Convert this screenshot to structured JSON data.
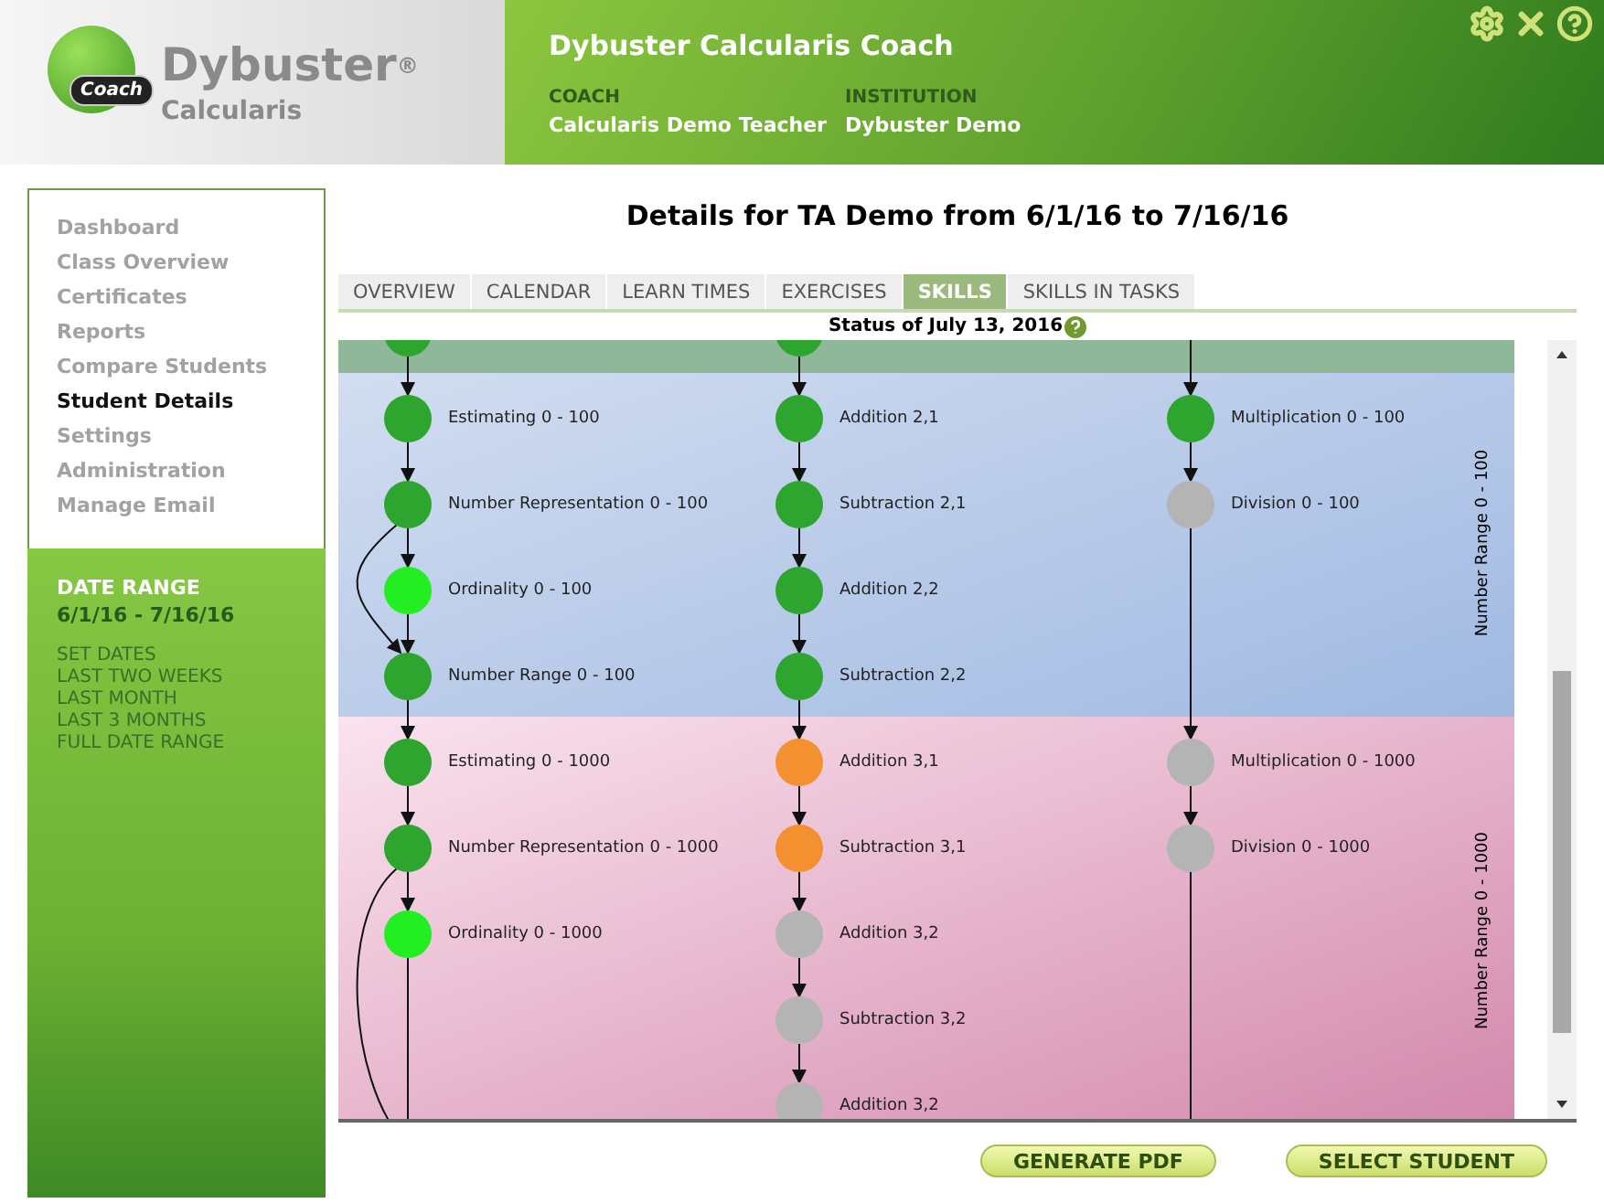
{
  "logo": {
    "badge": "Coach",
    "name": "Dybuster$^{®}$",
    "product": "Calcularis"
  },
  "header": {
    "title": "Dybuster Calcularis Coach",
    "fields": [
      {
        "label": "COACH",
        "value": "Calcularis Demo Teacher"
      },
      {
        "label": "INSTITUTION",
        "value": "Dybuster Demo"
      }
    ]
  },
  "sidebar": {
    "items": [
      {
        "label": "Dashboard",
        "selected": false
      },
      {
        "label": "Class Overview",
        "selected": false
      },
      {
        "label": "Certificates",
        "selected": false
      },
      {
        "label": "Reports",
        "selected": false
      },
      {
        "label": "Compare Students",
        "selected": false
      },
      {
        "label": "Student Details",
        "selected": true
      },
      {
        "label": "Settings",
        "selected": false
      },
      {
        "label": "Administration",
        "selected": false
      },
      {
        "label": "Manage Email",
        "selected": false
      }
    ],
    "date_range": {
      "title": "DATE RANGE",
      "value": "6/1/16 - 7/16/16",
      "links": [
        "SET DATES",
        "LAST TWO WEEKS",
        "LAST MONTH",
        "LAST 3 MONTHS",
        "FULL DATE RANGE"
      ]
    }
  },
  "title": "Details for TA Demo from 6/1/16 to 7/16/16",
  "tabs": [
    {
      "label": "OVERVIEW",
      "selected": false
    },
    {
      "label": "CALENDAR",
      "selected": false
    },
    {
      "label": "LEARN TIMES",
      "selected": false
    },
    {
      "label": "EXERCISES",
      "selected": false
    },
    {
      "label": "SKILLS",
      "selected": true
    },
    {
      "label": "SKILLS IN TASKS",
      "selected": false
    }
  ],
  "status": "Status of July 13, 2016",
  "skill_map": {
    "bands": [
      {
        "kind": "green",
        "columns": [
          [
            {
              "color": "#2ea52e"
            }
          ],
          [
            {
              "color": "#2ea52e"
            }
          ],
          []
        ]
      },
      {
        "kind": "blue",
        "label": "Number Range 0 - 100",
        "columns": [
          [
            {
              "label": "Estimating 0 - 100",
              "color": "#2ea52e"
            },
            {
              "label": "Number Representation 0 - 100",
              "color": "#2ea52e"
            },
            {
              "label": "Ordinality 0 - 100",
              "color": "#22ee22"
            },
            {
              "label": "Number Range 0 - 100",
              "color": "#2ea52e"
            }
          ],
          [
            {
              "label": "Addition 2,1",
              "color": "#2ea52e"
            },
            {
              "label": "Subtraction 2,1",
              "color": "#2ea52e"
            },
            {
              "label": "Addition 2,2",
              "color": "#2ea52e"
            },
            {
              "label": "Subtraction 2,2",
              "color": "#2ea52e"
            }
          ],
          [
            {
              "label": "Multiplication 0 - 100",
              "color": "#2ea52e"
            },
            {
              "label": "Division 0 - 100",
              "color": "#b4b4b4"
            }
          ]
        ]
      },
      {
        "kind": "pink",
        "label": "Number Range 0 - 1000",
        "columns": [
          [
            {
              "label": "Estimating 0 - 1000",
              "color": "#2ea52e"
            },
            {
              "label": "Number Representation 0 - 1000",
              "color": "#2ea52e"
            },
            {
              "label": "Ordinality 0 - 1000",
              "color": "#22ee22"
            }
          ],
          [
            {
              "label": "Addition 3,1",
              "color": "#f39030"
            },
            {
              "label": "Subtraction 3,1",
              "color": "#f39030"
            },
            {
              "label": "Addition 3,2",
              "color": "#b4b4b4"
            },
            {
              "label": "Subtraction 3,2",
              "color": "#b4b4b4"
            },
            {
              "label": "Addition 3,2",
              "color": "#b4b4b4"
            }
          ],
          [
            {
              "label": "Multiplication 0 - 1000",
              "color": "#b4b4b4"
            },
            {
              "label": "Division 0 - 1000",
              "color": "#b4b4b4"
            }
          ]
        ]
      }
    ]
  },
  "buttons": [
    "GENERATE PDF",
    "SELECT STUDENT"
  ]
}
